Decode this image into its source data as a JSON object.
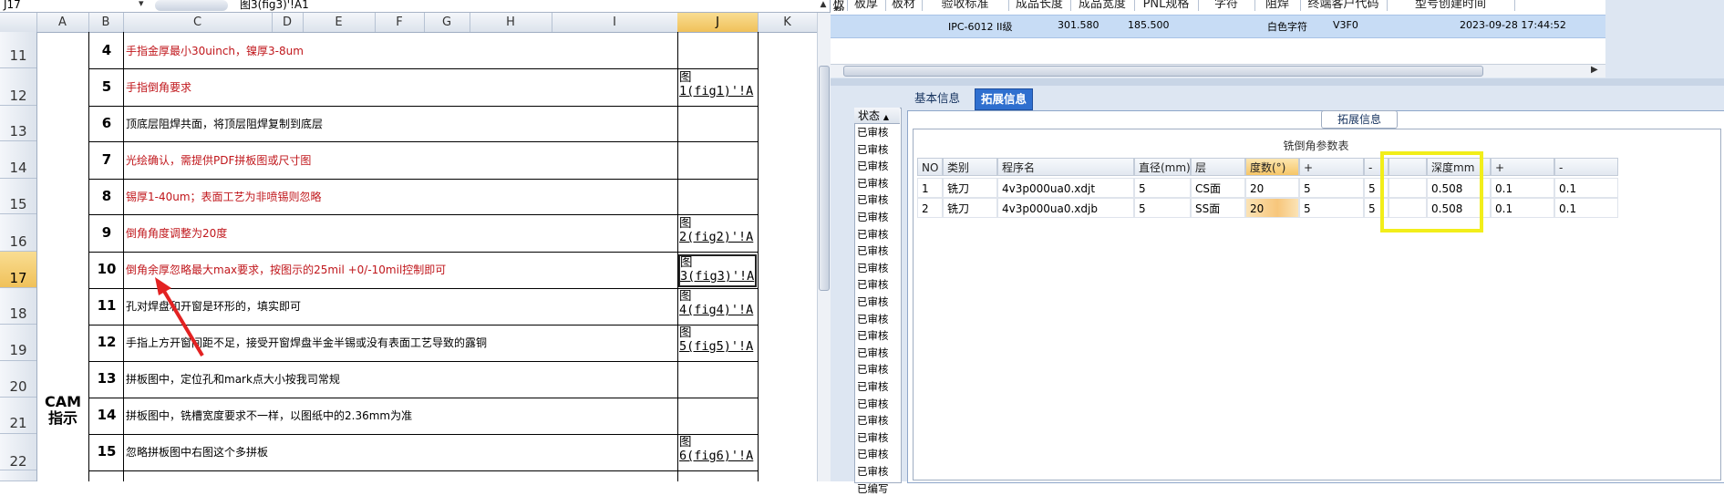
{
  "sheet": {
    "name_box": "J17",
    "formula": "图3(fig3)'!A1",
    "columns": [
      "A",
      "B",
      "C",
      "D",
      "E",
      "F",
      "G",
      "H",
      "I",
      "J",
      "K"
    ],
    "rows": [
      {
        "row": "11",
        "num": "4",
        "text": "手指金厚最小30uinch，镍厚3-8um",
        "red": true,
        "ref": ""
      },
      {
        "row": "12",
        "num": "5",
        "text": "手指倒角要求",
        "red": true,
        "ref": "图\n1(fig1)'!A"
      },
      {
        "row": "13",
        "num": "6",
        "text": "顶底层阻焊共面，将顶层阻焊复制到底层",
        "red": false,
        "ref": ""
      },
      {
        "row": "14",
        "num": "7",
        "text": "光绘确认，需提供PDF拼板图或尺寸图",
        "red": true,
        "ref": ""
      },
      {
        "row": "15",
        "num": "8",
        "text": "锡厚1-40um；表面工艺为非喷锡则忽略",
        "red": true,
        "ref": ""
      },
      {
        "row": "16",
        "num": "9",
        "text": "倒角角度调整为20度",
        "red": true,
        "ref": "图\n2(fig2)'!A"
      },
      {
        "row": "17",
        "num": "10",
        "text": "倒角余厚忽略最大max要求，按图示的25mil +0/-10mil控制即可",
        "red": true,
        "ref": "图\n3(fig3)'!A"
      },
      {
        "row": "18",
        "num": "11",
        "text": "孔对焊盘和开窗是环形的，填实即可",
        "red": false,
        "ref": "图\n4(fig4)'!A"
      },
      {
        "row": "19",
        "num": "12",
        "text": "手指上方开窗间距不足，接受开窗焊盘半金半锡或没有表面工艺导致的露铜",
        "red": false,
        "ref": "图\n5(fig5)'!A"
      },
      {
        "row": "20",
        "num": "13",
        "text": "拼板图中，定位孔和mark点大小按我司常规",
        "red": false,
        "ref": ""
      },
      {
        "row": "21",
        "num": "14",
        "text": "拼板图中，铣槽宽度要求不一样，以图纸中的2.36mm为准",
        "red": false,
        "ref": ""
      },
      {
        "row": "22",
        "num": "15",
        "text": "忽略拼板图中右图这个多拼板",
        "red": false,
        "ref": "图\n6(fig6)'!A"
      }
    ],
    "cam_label": "CAM\n指示"
  },
  "top_grid": {
    "headers": [
      "板数",
      "板厚",
      "板材",
      "验收标准",
      "成品长度",
      "成品宽度",
      "PNL规格",
      "字符",
      "阻焊",
      "终端客户代码",
      "型号创建时间"
    ],
    "row": [
      "",
      "",
      "",
      "IPC-6012 II级",
      "301.580",
      "185.500",
      "",
      "白色字符",
      "",
      "V3F0",
      "2023-09-28 17:44:52"
    ]
  },
  "status": {
    "header": "状态",
    "items": [
      "已审核",
      "已审核",
      "已审核",
      "已审核",
      "已审核",
      "已审核",
      "已审核",
      "已审核",
      "已审核",
      "已审核",
      "已审核",
      "已审核",
      "已审核",
      "已审核",
      "已审核",
      "已审核",
      "已审核",
      "已审核",
      "已审核",
      "已审核",
      "已审核",
      "已编写"
    ]
  },
  "tabs": {
    "basic": "基本信息",
    "extended": "拓展信息"
  },
  "group_title": "拓展信息",
  "param_table": {
    "title": "铣倒角参数表",
    "headers": [
      "NO",
      "类别",
      "程序名",
      "直径(mm)",
      "层",
      "度数(°)",
      "+",
      "-",
      "",
      "深度mm",
      "+",
      "-"
    ],
    "rows": [
      [
        "1",
        "铣刀",
        "4v3p000ua0.xdjt",
        "5",
        "CS面",
        "20",
        "5",
        "5",
        "",
        "0.508",
        "0.1",
        "0.1"
      ],
      [
        "2",
        "铣刀",
        "4v3p000ua0.xdjb",
        "5",
        "SS面",
        "20",
        "5",
        "5",
        "",
        "0.508",
        "0.1",
        "0.1"
      ]
    ]
  },
  "colors": {
    "accent_tab": "#2f6fcf",
    "highlight_box": "#f2ee1a",
    "red_text": "#c0161b",
    "arrow": "#e32222"
  }
}
